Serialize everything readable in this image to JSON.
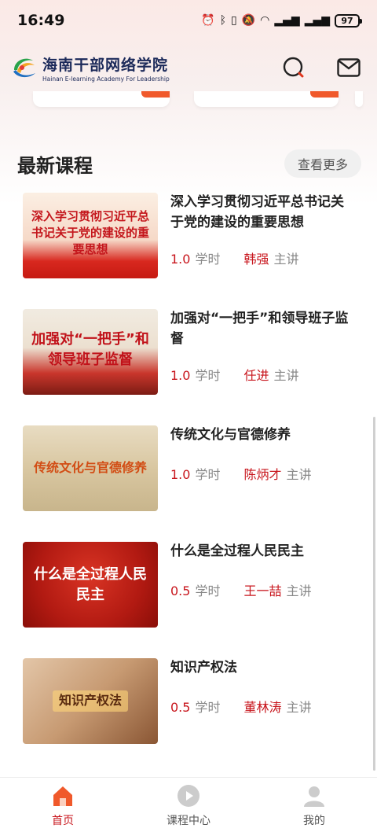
{
  "status_bar": {
    "time": "16:49",
    "icons": [
      "alarm-icon",
      "bluetooth-icon",
      "vibrate-icon",
      "mute-icon",
      "wifi-icon",
      "signal-4g-icon",
      "signal-4g-icon"
    ],
    "battery": "97"
  },
  "header": {
    "logo_cn": "海南干部网络学院",
    "logo_en": "Hainan E-learning Academy For Leadership",
    "search_icon": "search-icon",
    "mail_icon": "mail-icon"
  },
  "section": {
    "title": "最新课程",
    "more_label": "查看更多"
  },
  "courses": [
    {
      "thumb_text": "深入学习贯彻习近平总书记关于党的建设的重要思想",
      "title": "深入学习贯彻习近平总书记关于党的建设的重要思想",
      "hours": "1.0",
      "hours_unit": "学时",
      "lecturer": "韩强",
      "lecturer_role": "主讲"
    },
    {
      "thumb_text": "加强对“一把手”和领导班子监督",
      "title": "加强对“一把手”和领导班子监督",
      "hours": "1.0",
      "hours_unit": "学时",
      "lecturer": "任进",
      "lecturer_role": "主讲"
    },
    {
      "thumb_text": "传统文化与官德修养",
      "title": "传统文化与官德修养",
      "hours": "1.0",
      "hours_unit": "学时",
      "lecturer": "陈炳才",
      "lecturer_role": "主讲"
    },
    {
      "thumb_text": "什么是全过程人民民主",
      "title": "什么是全过程人民民主",
      "hours": "0.5",
      "hours_unit": "学时",
      "lecturer": "王一喆",
      "lecturer_role": "主讲"
    },
    {
      "thumb_text": "知识产权法",
      "title": "知识产权法",
      "hours": "0.5",
      "hours_unit": "学时",
      "lecturer": "董林涛",
      "lecturer_role": "主讲"
    }
  ],
  "tabbar": {
    "items": [
      {
        "label": "首页",
        "icon": "home-icon",
        "active": true
      },
      {
        "label": "课程中心",
        "icon": "play-icon",
        "active": false
      },
      {
        "label": "我的",
        "icon": "user-icon",
        "active": false
      }
    ]
  },
  "colors": {
    "accent": "#c8161d",
    "muted": "#888888",
    "tab_inactive": "#cccccc",
    "tab_active": "#f0592b"
  }
}
